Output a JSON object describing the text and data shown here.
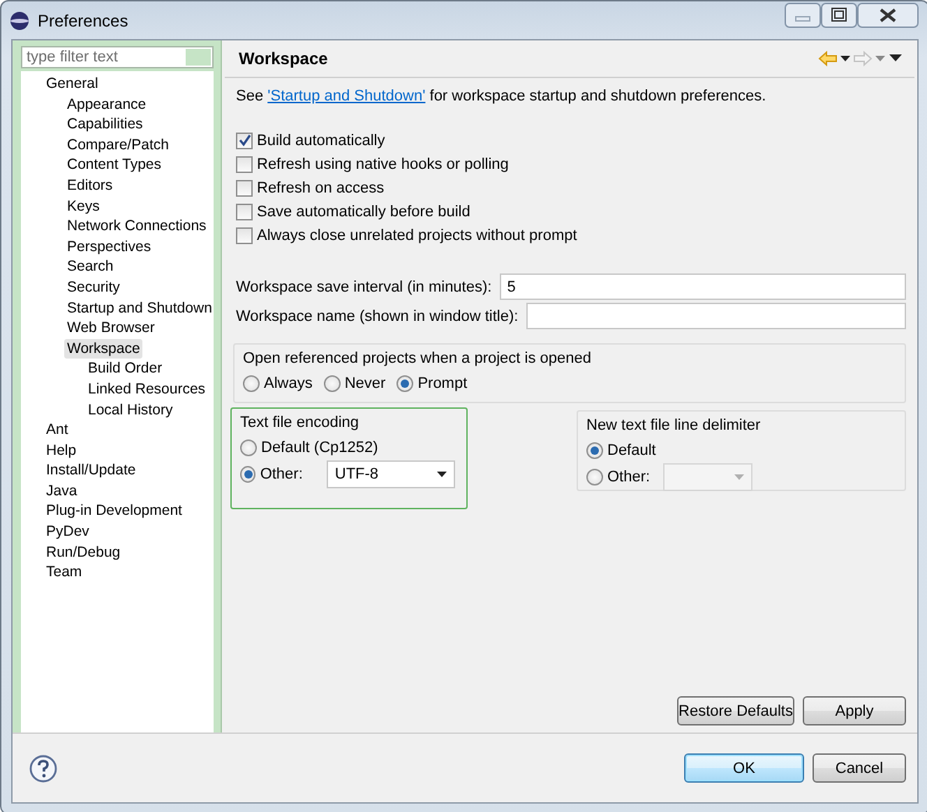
{
  "window": {
    "title": "Preferences"
  },
  "sidebar": {
    "filter": {
      "placeholder": "type filter text"
    },
    "items": [
      {
        "label": "General",
        "selected": false,
        "children": [
          {
            "label": "Appearance",
            "selected": false
          },
          {
            "label": "Capabilities",
            "selected": false
          },
          {
            "label": "Compare/Patch",
            "selected": false
          },
          {
            "label": "Content Types",
            "selected": false
          },
          {
            "label": "Editors",
            "selected": false
          },
          {
            "label": "Keys",
            "selected": false
          },
          {
            "label": "Network Connections",
            "selected": false
          },
          {
            "label": "Perspectives",
            "selected": false
          },
          {
            "label": "Search",
            "selected": false
          },
          {
            "label": "Security",
            "selected": false
          },
          {
            "label": "Startup and Shutdown",
            "selected": false
          },
          {
            "label": "Web Browser",
            "selected": false
          },
          {
            "label": "Workspace",
            "selected": true,
            "children": [
              {
                "label": "Build Order",
                "selected": false
              },
              {
                "label": "Linked Resources",
                "selected": false
              },
              {
                "label": "Local History",
                "selected": false
              }
            ]
          }
        ]
      },
      {
        "label": "Ant",
        "selected": false
      },
      {
        "label": "Help",
        "selected": false
      },
      {
        "label": "Install/Update",
        "selected": false
      },
      {
        "label": "Java",
        "selected": false
      },
      {
        "label": "Plug-in Development",
        "selected": false
      },
      {
        "label": "PyDev",
        "selected": false
      },
      {
        "label": "Run/Debug",
        "selected": false
      },
      {
        "label": "Team",
        "selected": false
      }
    ]
  },
  "page": {
    "title": "Workspace",
    "description": {
      "before": "See",
      "link": "'Startup and Shutdown'",
      "after": "for workspace startup and shutdown preferences."
    },
    "checkboxes": [
      {
        "label": "Build automatically",
        "checked": true
      },
      {
        "label": "Refresh using native hooks or polling",
        "checked": false
      },
      {
        "label": "Refresh on access",
        "checked": false
      },
      {
        "label": "Save automatically before build",
        "checked": false
      },
      {
        "label": "Always close unrelated projects without prompt",
        "checked": false
      }
    ],
    "fields": [
      {
        "label": "Workspace save interval (in minutes):",
        "value": "5"
      },
      {
        "label": "Workspace name (shown in window title):"
      }
    ],
    "open_referenced_projects": {
      "title": "Open referenced projects when a project is opened",
      "options": [
        {
          "label": "Always",
          "selected": false
        },
        {
          "label": "Never",
          "selected": false
        },
        {
          "label": "Prompt",
          "selected": true
        }
      ]
    },
    "encoding_groups": [
      {
        "title": "Text file encoding",
        "highlighted": true,
        "options": [
          {
            "label": "Default (Cp1252)",
            "selected": false
          },
          {
            "label": "Other:",
            "selected": true,
            "combo": {
              "value": "UTF-8",
              "disabled": false
            }
          }
        ]
      },
      {
        "title": "New text file line delimiter",
        "highlighted": false,
        "options": [
          {
            "label": "Default",
            "selected": true
          },
          {
            "label": "Other:",
            "selected": false,
            "combo": {
              "disabled": true
            }
          }
        ]
      }
    ],
    "buttons": [
      {
        "label": "Restore Defaults"
      },
      {
        "label": "Apply"
      }
    ]
  },
  "dialog_buttons": [
    {
      "label": "OK",
      "default": true
    },
    {
      "label": "Cancel",
      "default": false
    }
  ]
}
